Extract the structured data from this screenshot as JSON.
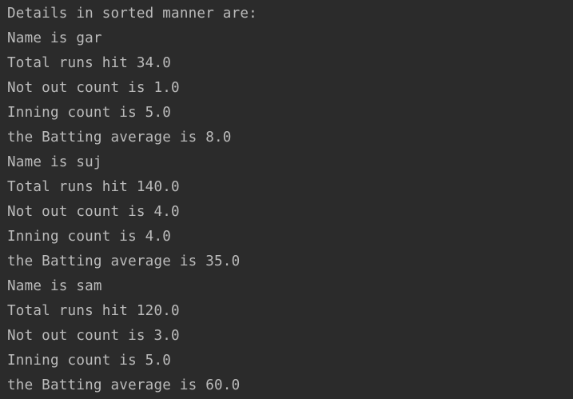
{
  "console": {
    "lines": [
      "Details in sorted manner are:",
      "Name is gar",
      "Total runs hit 34.0",
      "Not out count is 1.0",
      "Inning count is 5.0",
      "the Batting average is 8.0",
      "Name is suj",
      "Total runs hit 140.0",
      "Not out count is 4.0",
      "Inning count is 4.0",
      "the Batting average is 35.0",
      "Name is sam",
      "Total runs hit 120.0",
      "Not out count is 3.0",
      "Inning count is 5.0",
      "the Batting average is 60.0"
    ]
  },
  "colors": {
    "background": "#2b2b2b",
    "text": "#bbbbbb"
  }
}
